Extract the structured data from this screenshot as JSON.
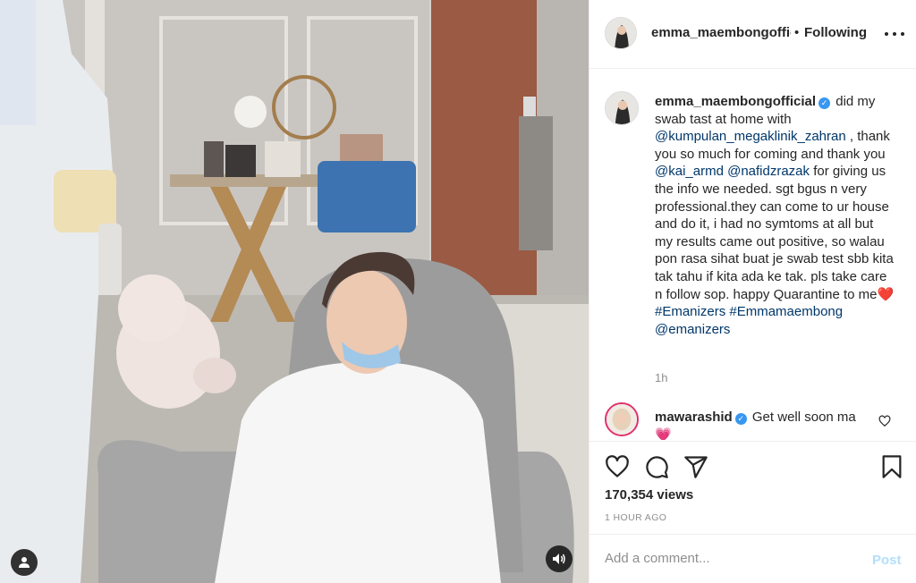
{
  "post": {
    "username_header": "emma_maembongofficial",
    "follow_dot": "•",
    "follow_status": "Following",
    "caption": {
      "username": "emma_maembongofficial",
      "verified_icon": "verified-badge-icon",
      "text_1": "did my swab tast at home with ",
      "mention_1": "@kumpulan_megaklinik_zahran",
      "text_2": " , thank you so much for coming and thank you ",
      "mention_2": "@kai_armd",
      "text_3": " ",
      "mention_3": "@nafidzrazak",
      "text_4": " for giving us the info we needed. sgt bgus n very professional.they can come to ur house and do it, i had no symtoms at all but my results came out positive, so walau pon rasa sihat buat je swab test sbb kita tak tahu if kita ada ke tak. pls take care n follow sop. happy Quarantine to me",
      "emoji": "❤️",
      "hashtag_1": "#Emanizers",
      "hashtag_2": "#Emmamaembong",
      "mention_4": "@emanizers",
      "time": "1h"
    },
    "comments": [
      {
        "username": "mawarashid",
        "verified_icon": "verified-badge-icon",
        "text": "Get well soon ma",
        "emoji": "💗"
      }
    ],
    "actions": {
      "like_icon": "heart-icon",
      "comment_icon": "comment-icon",
      "share_icon": "paper-plane-icon",
      "save_icon": "bookmark-icon"
    },
    "views": "170,354 views",
    "posted_ago": "1 HOUR AGO",
    "add_comment": {
      "placeholder": "Add a comment...",
      "post_label": "Post"
    },
    "colors": {
      "link": "#00376b",
      "verified": "#3897f0",
      "post_disabled": "#b2dffc",
      "muted": "#8e8e8e"
    }
  }
}
